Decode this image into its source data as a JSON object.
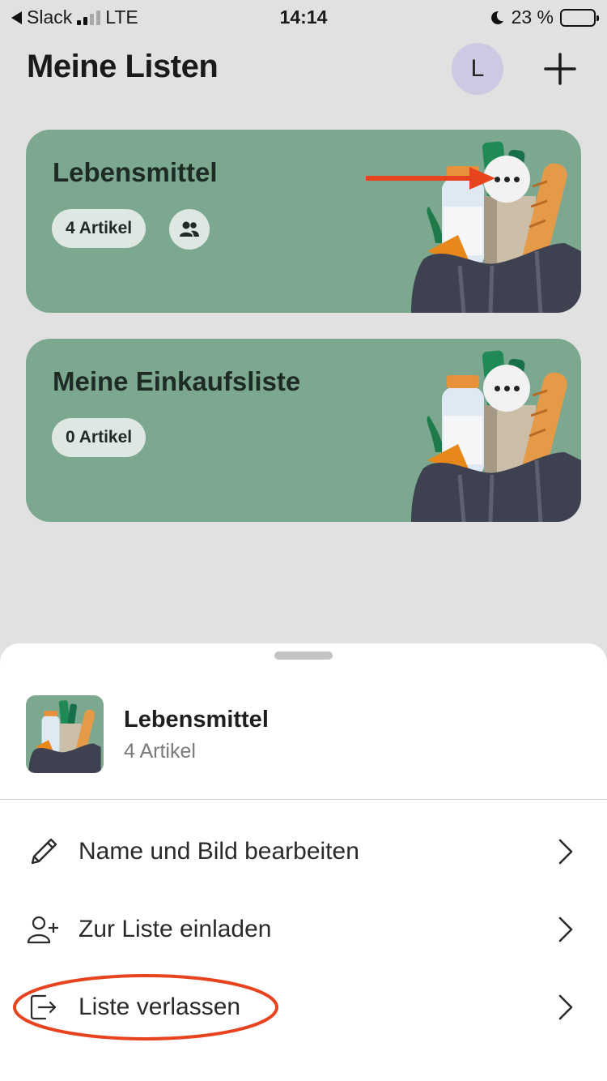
{
  "status_bar": {
    "back_app": "Slack",
    "network": "LTE",
    "time": "14:14",
    "battery": "23 %",
    "battery_level": 0.23
  },
  "header": {
    "title": "Meine Listen",
    "avatar_initial": "L",
    "add_icon": "plus-icon"
  },
  "lists": [
    {
      "name": "Lebensmittel",
      "count_label": "4 Artikel",
      "shared": true,
      "shared_icon": "people-icon",
      "more_icon": "more-icon"
    },
    {
      "name": "Meine Einkaufsliste",
      "count_label": "0 Artikel",
      "shared": false,
      "more_icon": "more-icon"
    }
  ],
  "sheet": {
    "list_name": "Lebensmittel",
    "list_count": "4 Artikel",
    "actions": [
      {
        "label": "Name und Bild bearbeiten",
        "icon": "pencil-icon"
      },
      {
        "label": "Zur Liste einladen",
        "icon": "add-person-icon"
      },
      {
        "label": "Liste verlassen",
        "icon": "exit-icon"
      }
    ]
  },
  "colors": {
    "card": "#7ba88e",
    "background": "#e1e1e1",
    "avatar": "#cfc8e3",
    "annotation": "#e8431f"
  }
}
